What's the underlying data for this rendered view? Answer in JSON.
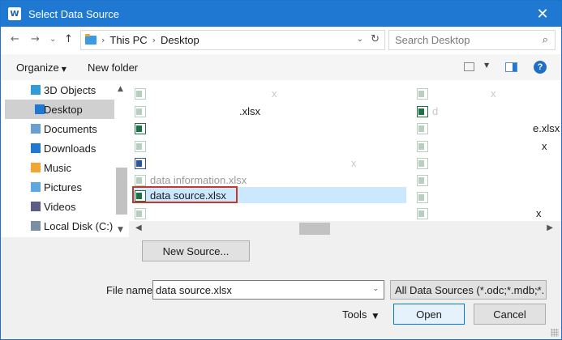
{
  "window": {
    "title": "Select Data Source",
    "app_icon": "word-app-icon",
    "close_glyph": "✕"
  },
  "nav": {
    "back_glyph": "←",
    "forward_glyph": "→",
    "recent_glyph": "⌄",
    "up_glyph": "↑",
    "breadcrumb": [
      "This PC",
      "Desktop"
    ],
    "search_placeholder": "Search Desktop"
  },
  "toolbar": {
    "organize": "Organize",
    "new_folder": "New folder",
    "help_glyph": "?"
  },
  "sidebar": {
    "items": [
      {
        "label": "3D Objects",
        "icon": "3d-objects-icon",
        "color": "#2f9bd8",
        "selected": false
      },
      {
        "label": "Desktop",
        "icon": "desktop-folder-icon",
        "color": "#1f78d1",
        "selected": true
      },
      {
        "label": "Documents",
        "icon": "documents-icon",
        "color": "#6a9fd4",
        "selected": false
      },
      {
        "label": "Downloads",
        "icon": "downloads-icon",
        "color": "#1f78d1",
        "selected": false
      },
      {
        "label": "Music",
        "icon": "music-icon",
        "color": "#f3a531",
        "selected": false
      },
      {
        "label": "Pictures",
        "icon": "pictures-icon",
        "color": "#5fa7e0",
        "selected": false
      },
      {
        "label": "Videos",
        "icon": "videos-icon",
        "color": "#5c5c8a",
        "selected": false
      },
      {
        "label": "Local Disk (C:)",
        "icon": "local-disk-icon",
        "color": "#7a8fa6",
        "selected": false
      }
    ]
  },
  "files": {
    "col1": [
      {
        "type": "excel",
        "name": "",
        "tail": "x"
      },
      {
        "type": "excel",
        "name": "",
        "tail": ".xlsx"
      },
      {
        "type": "excel",
        "name": "",
        "tail": ""
      },
      {
        "type": "excel",
        "name": "",
        "tail": ""
      },
      {
        "type": "word",
        "name": "",
        "tail": "x"
      },
      {
        "type": "excel",
        "name": "data information.xlsx",
        "tail": ""
      },
      {
        "type": "excel",
        "name": "data source.xlsx",
        "tail": "",
        "selected": true
      },
      {
        "type": "excel",
        "name": "",
        "tail": ""
      }
    ],
    "col2": [
      {
        "type": "excel",
        "tail": "x"
      },
      {
        "type": "excel",
        "tail": "d"
      },
      {
        "type": "excel",
        "tail": "e.xlsx"
      },
      {
        "type": "excel",
        "tail": "x"
      },
      {
        "type": "excel",
        "tail": ""
      },
      {
        "type": "excel",
        "tail": ""
      },
      {
        "type": "excel",
        "tail": ""
      },
      {
        "type": "excel",
        "tail": "x"
      }
    ]
  },
  "buttons": {
    "new_source": "New Source...",
    "tools": "Tools",
    "open": "Open",
    "cancel": "Cancel"
  },
  "filename": {
    "label": "File name:",
    "value": "data source.xlsx"
  },
  "filter": {
    "value": "All Data Sources (*.odc;*.mdb;*."
  }
}
